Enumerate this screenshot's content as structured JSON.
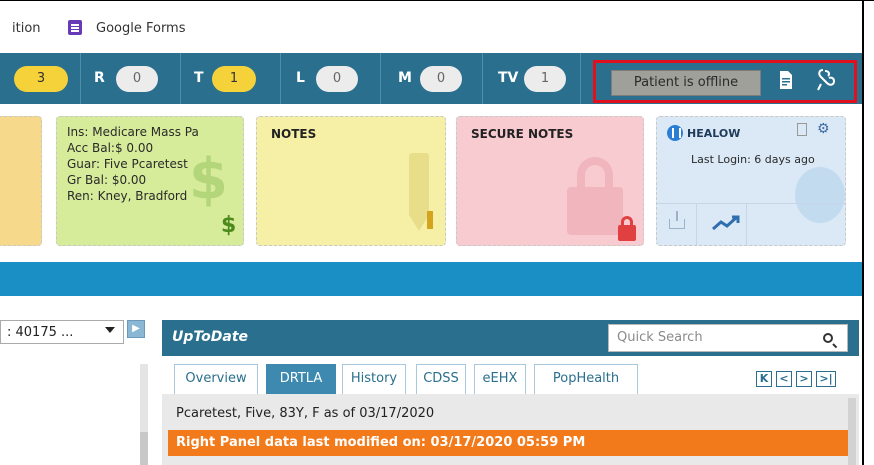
{
  "bookmarks": {
    "partial": "ition",
    "google_forms": "Google Forms"
  },
  "counters": [
    {
      "label": "",
      "count": "3",
      "highlight": true
    },
    {
      "label": "R",
      "count": "0",
      "highlight": false
    },
    {
      "label": "T",
      "count": "1",
      "highlight": true
    },
    {
      "label": "L",
      "count": "0",
      "highlight": false
    },
    {
      "label": "M",
      "count": "0",
      "highlight": false
    },
    {
      "label": "TV",
      "count": "1",
      "highlight": false
    }
  ],
  "status": {
    "offline_label": "Patient is offline"
  },
  "cards": {
    "insurance": {
      "lines": [
        "Ins: Medicare Mass Pa",
        "Acc Bal:$ 0.00",
        "Guar: Five Pcaretest",
        "Gr Bal: $0.00",
        "Ren: Kney, Bradford"
      ],
      "symbol": "$"
    },
    "notes": {
      "title": "NOTES"
    },
    "secure_notes": {
      "title": "SECURE NOTES"
    },
    "healow": {
      "title": "HEALOW",
      "last_login": "Last Login: 6 days ago"
    }
  },
  "left_panel": {
    "select_value": ": 40175 ..."
  },
  "uptodate": {
    "title": "UpToDate",
    "search_placeholder": "Quick Search",
    "tabs": [
      "Overview",
      "DRTLA",
      "History",
      "CDSS",
      "eEHX",
      "PopHealth"
    ],
    "active_tab": "DRTLA",
    "pager": [
      "K",
      "<",
      ">",
      ">|"
    ],
    "patient_line": "Pcaretest, Five, 83Y, F as of 03/17/2020",
    "alert_line": "Right Panel data last modified on: 03/17/2020 05:59 PM"
  },
  "colors": {
    "toolbar": "#2a6f8e",
    "band": "#1a8fc6",
    "alert": "#f27a1a",
    "offline_border": "#e0101e"
  }
}
